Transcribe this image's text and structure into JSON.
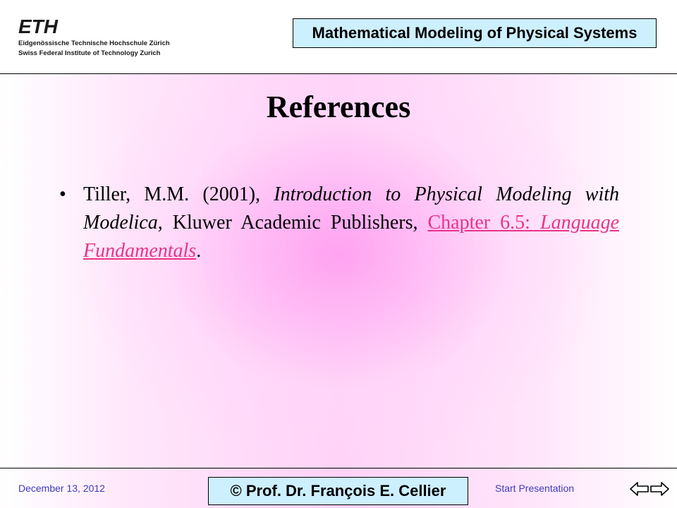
{
  "header": {
    "logo_text": "ETH",
    "institution_line1": "Eidgenössische Technische Hochschule Zürich",
    "institution_line2": "Swiss Federal Institute of Technology Zurich",
    "course_title": "Mathematical Modeling of Physical Systems"
  },
  "slide": {
    "title": "References",
    "bullet_symbol": "•",
    "reference": {
      "authors_year": "Tiller, M.M. (2001), ",
      "book_title": "Introduction to Physical Modeling with Modelica",
      "publisher": ", Kluwer Academic Publishers, ",
      "link_plain": "Chapter 6.5: ",
      "link_italic": "Language Fundamentals",
      "end": "."
    }
  },
  "footer": {
    "date": "December 13, 2012",
    "author": "© Prof. Dr. François E. Cellier",
    "start_presentation": "Start Presentation",
    "prev_icon": "left-arrow-icon",
    "next_icon": "right-arrow-icon"
  },
  "colors": {
    "link": "#e8338a",
    "box_fill": "#cdf0ff",
    "footer_text": "#3b3bbb"
  }
}
